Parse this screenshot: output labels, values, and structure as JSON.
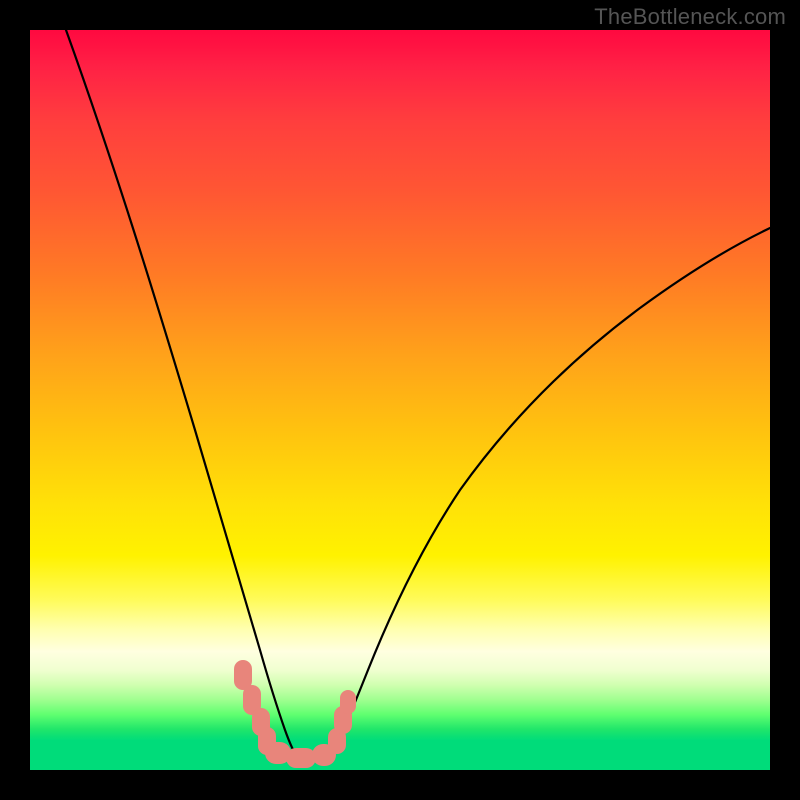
{
  "watermark": "TheBottleneck.com",
  "chart_data": {
    "type": "line",
    "title": "",
    "xlabel": "",
    "ylabel": "",
    "xlim": [
      0,
      100
    ],
    "ylim": [
      0,
      100
    ],
    "grid": false,
    "series": [
      {
        "name": "left-curve",
        "x": [
          5,
          10,
          15,
          20,
          22,
          24,
          26,
          28,
          29,
          30,
          31,
          32,
          33,
          34,
          35,
          36
        ],
        "values": [
          100,
          85,
          69,
          51,
          44,
          37,
          29,
          21,
          16,
          13,
          10,
          7.5,
          5.5,
          4,
          3,
          2.5
        ]
      },
      {
        "name": "right-curve",
        "x": [
          40,
          41,
          42,
          43,
          44,
          46,
          48,
          50,
          55,
          60,
          65,
          70,
          75,
          80,
          85,
          90,
          95,
          100
        ],
        "values": [
          2.5,
          3,
          4,
          5.5,
          7.5,
          11,
          15,
          19,
          28,
          36,
          43,
          49,
          55,
          60,
          64,
          68,
          71.5,
          74
        ]
      },
      {
        "name": "bottom-marker-band",
        "x": [
          28,
          40
        ],
        "values": [
          4,
          4
        ]
      }
    ],
    "gradient_stops": [
      {
        "pos": 0,
        "color": "#ff0940"
      },
      {
        "pos": 22,
        "color": "#ff5733"
      },
      {
        "pos": 54,
        "color": "#ffc20f"
      },
      {
        "pos": 71,
        "color": "#fff200"
      },
      {
        "pos": 86,
        "color": "#e8ffd0"
      },
      {
        "pos": 96,
        "color": "#00dc7a"
      },
      {
        "pos": 100,
        "color": "#00dc7a"
      }
    ]
  }
}
